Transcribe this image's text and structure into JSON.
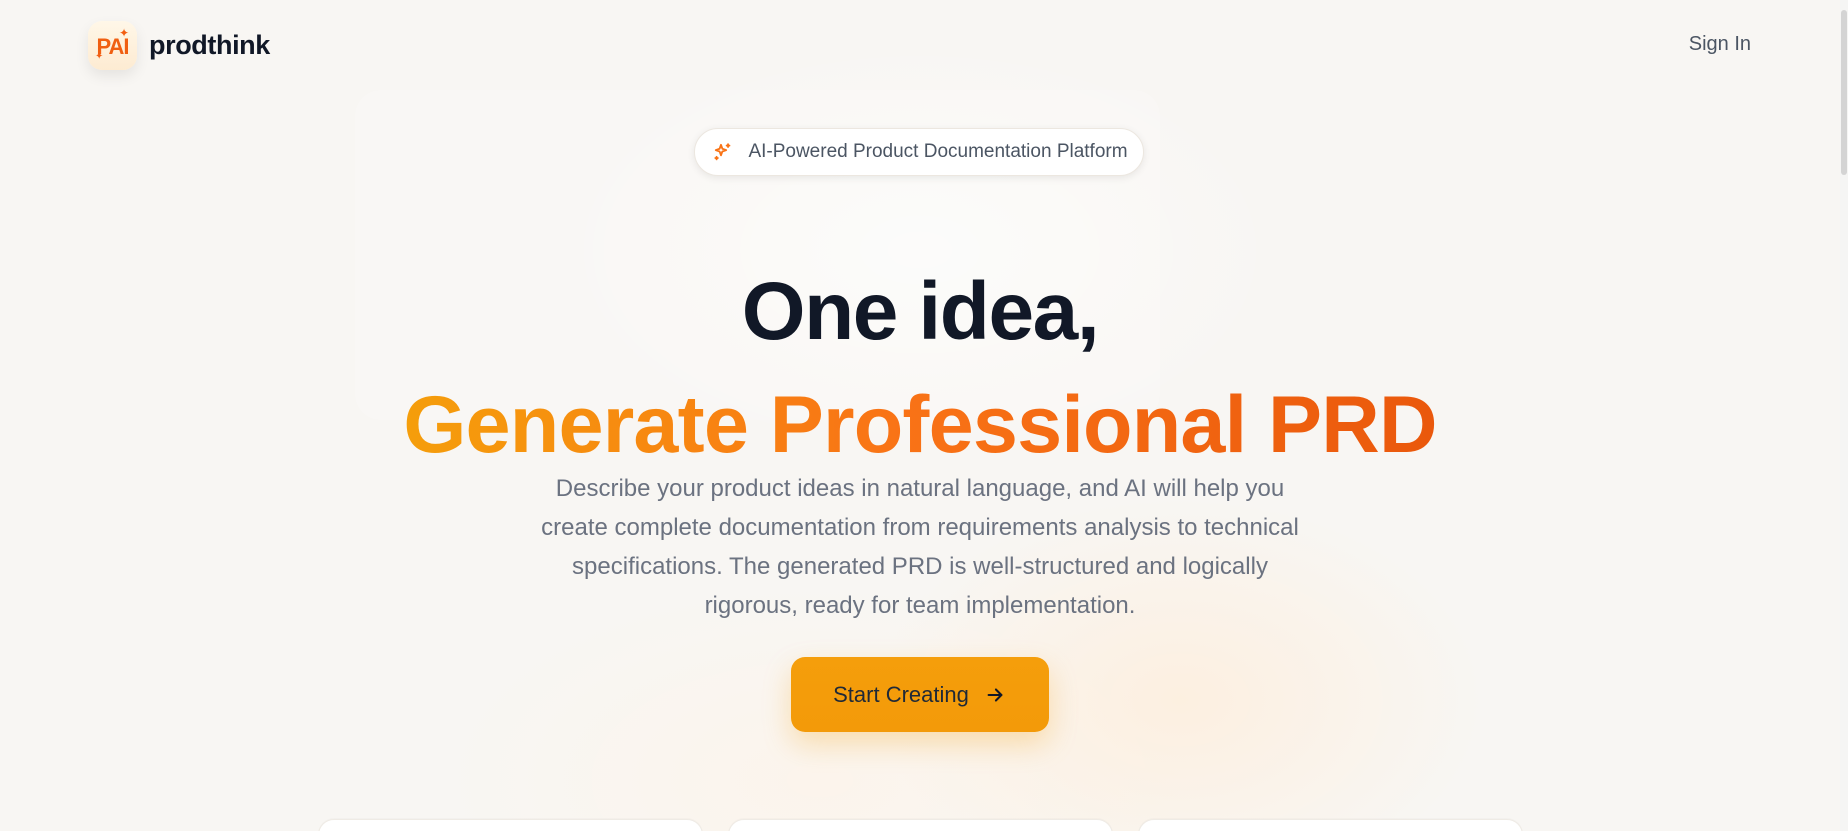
{
  "header": {
    "logo_text": "PAI",
    "brand_name": "prodthink",
    "signin_label": "Sign In"
  },
  "hero": {
    "badge_text": "AI-Powered Product Documentation Platform",
    "title_line_1": "One idea,",
    "title_line_2": "Generate Professional PRD",
    "description": "Describe your product ideas in natural language, and AI will help you create complete documentation from requirements analysis to technical specifications. The generated PRD is well-structured and logically rigorous, ready for team implementation.",
    "cta_label": "Start Creating"
  },
  "icons": {
    "logo_sparkle": "sparkle-icon",
    "badge_icon": "sparkles-icon",
    "cta_icon": "arrow-right-icon"
  },
  "colors": {
    "background": "#f8f6f3",
    "brand_text": "#111827",
    "title_dark": "#111827",
    "accent_start": "#f59e0b",
    "accent_mid": "#f97316",
    "accent_end": "#ea580c",
    "body_text": "#6b7280",
    "button": "#f59e0b"
  }
}
